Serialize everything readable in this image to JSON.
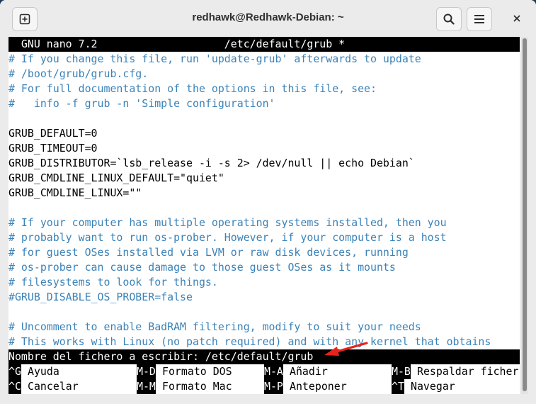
{
  "window": {
    "title": "redhawk@Redhawk-Debian: ~"
  },
  "titlebar_icons": {
    "new_tab": "new-tab-icon",
    "search": "search-icon",
    "menu": "hamburger-menu-icon",
    "close": "close-icon"
  },
  "nano": {
    "header": "  GNU nano 7.2                    /etc/default/grub *",
    "lines": [
      "# If you change this file, run 'update-grub' afterwards to update",
      "# /boot/grub/grub.cfg.",
      "# For full documentation of the options in this file, see:",
      "#   info -f grub -n 'Simple configuration'",
      "",
      "GRUB_DEFAULT=0",
      "GRUB_TIMEOUT=0",
      "GRUB_DISTRIBUTOR=`lsb_release -i -s 2> /dev/null || echo Debian`",
      "GRUB_CMDLINE_LINUX_DEFAULT=\"quiet\"",
      "GRUB_CMDLINE_LINUX=\"\"",
      "",
      "# If your computer has multiple operating systems installed, then you",
      "# probably want to run os-prober. However, if your computer is a host",
      "# for guest OSes installed via LVM or raw disk devices, running",
      "# os-prober can cause damage to those guest OSes as it mounts",
      "# filesystems to look for things.",
      "#GRUB_DISABLE_OS_PROBER=false",
      "",
      "# Uncomment to enable BadRAM filtering, modify to suit your needs",
      "# This works with Linux (no patch required) and with any kernel that obtains"
    ],
    "prompt": "Nombre del fichero a escribir: /etc/default/grub",
    "shortcuts": [
      {
        "key": "^G",
        "label": "Ayuda"
      },
      {
        "key": "M-D",
        "label": "Formato DOS"
      },
      {
        "key": "M-A",
        "label": "Añadir"
      },
      {
        "key": "M-B",
        "label": "Respaldar ficher"
      },
      {
        "key": "^C",
        "label": "Cancelar"
      },
      {
        "key": "M-M",
        "label": "Formato Mac"
      },
      {
        "key": "M-P",
        "label": "Anteponer"
      },
      {
        "key": "^T",
        "label": "Navegar"
      }
    ]
  },
  "colors": {
    "comment": "#3a82b8",
    "arrow": "#e8231c"
  }
}
